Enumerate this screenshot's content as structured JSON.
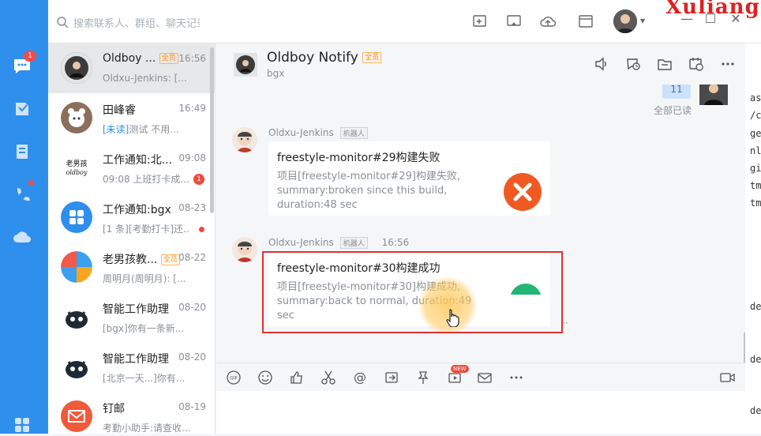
{
  "nav": {
    "badge_count": "1"
  },
  "search": {
    "placeholder": "搜索联系人、群组、聊天记录"
  },
  "brand": "Xuliang",
  "conversations": [
    {
      "name": "Oldboy ...",
      "tag": "全员",
      "time": "16:56",
      "preview": "Oldxu-Jenkins: [...",
      "active": true
    },
    {
      "name": "田峰睿",
      "tag": "",
      "time": "16:49",
      "preview_hl": "[未读]",
      "preview": "测试 不用..."
    },
    {
      "name": "工作通知:北...",
      "tag": "",
      "time": "09:08",
      "preview": "09:08 上班打卡成...",
      "count": "1"
    },
    {
      "name": "工作通知:bgx",
      "tag": "",
      "time": "08-23",
      "preview": "[1 条][考勤打卡]还..."
    },
    {
      "name": "老男孩教...",
      "tag": "全员",
      "time": "08-22",
      "preview": "周明月(周明月): [..."
    },
    {
      "name": "智能工作助理",
      "tag": "",
      "time": "08-20",
      "preview": "[bgx]你有一条新..."
    },
    {
      "name": "智能工作助理",
      "tag": "",
      "time": "08-20",
      "preview": "[北京一天...]你有..."
    },
    {
      "name": "钉邮",
      "tag": "",
      "time": "08-19",
      "preview": "考勤小助手:请查收..."
    }
  ],
  "chat": {
    "title": "Oldboy Notify",
    "tag": "全员",
    "subtitle": "bgx",
    "my_bubble": "11",
    "read_status": "全部已读",
    "messages": [
      {
        "sender": "Oldxu-Jenkins",
        "robot": "机器人",
        "time": "",
        "title": "freestyle-monitor#29构建失败",
        "body": "项目[freestyle-monitor#29]构建失败, summary:broken since this build, duration:48 sec"
      },
      {
        "sender": "Oldxu-Jenkins",
        "robot": "机器人",
        "time": "16:56",
        "title": "freestyle-monitor#30构建成功",
        "body": "项目[freestyle-monitor#30]构建成功, summary:back to normal, duration:49 sec"
      }
    ],
    "new_badge": "NEW"
  },
  "right_strip": [
    "as",
    "/c",
    "ge",
    "nl",
    "gi",
    "tm",
    "tm",
    "de",
    "de",
    "de"
  ]
}
